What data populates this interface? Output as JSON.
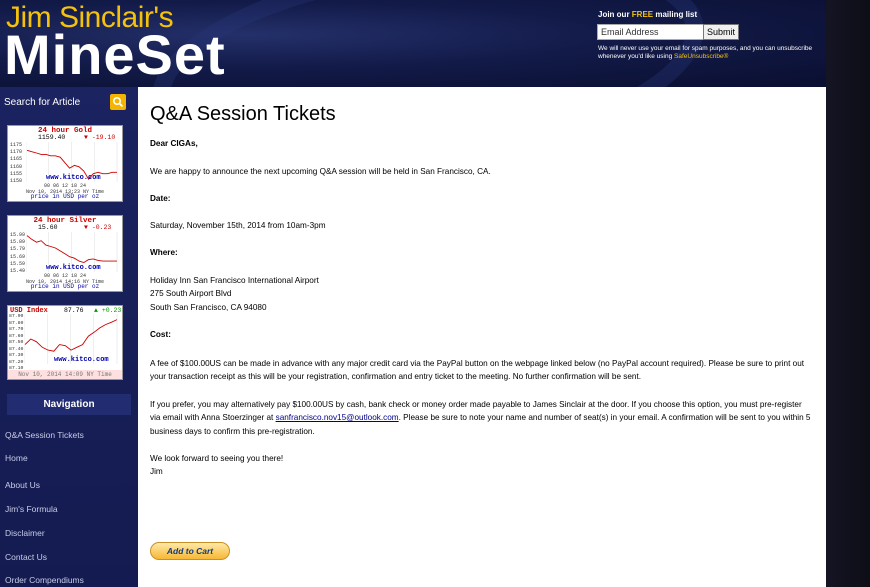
{
  "header": {
    "brand_top": "Jim Sinclair's",
    "brand_main": "MineSet",
    "mailing": {
      "title_prefix": "Join our ",
      "title_free": "FREE",
      "title_suffix": " mailing list",
      "email_value": "Email Address",
      "submit_label": "Submit",
      "note": "We will never use your email for spam purposes, and you can unsubscribe whenever you'd like using ",
      "note_link": "SafeUnsubscribe®"
    }
  },
  "sidebar": {
    "search_label": "Search for Article",
    "gold": {
      "title": "24 hour Gold",
      "price": "1159.40",
      "change": "-19.10",
      "y_ticks": [
        "1175",
        "1170",
        "1165",
        "1160",
        "1155",
        "1150"
      ],
      "source": "www.kitco.com",
      "x_note": "00 06 12 18 24",
      "date_note": "Nov 10, 2014 13:23 NY Time",
      "unit_note": "price in USD per oz",
      "series": [
        1171,
        1170,
        1169,
        1168,
        1168,
        1167,
        1167,
        1166,
        1162,
        1158,
        1160,
        1159,
        1156,
        1150,
        1154,
        1155,
        1154,
        1154,
        1155,
        1155
      ],
      "ylim": [
        1148,
        1177
      ]
    },
    "silver": {
      "title": "24 hour Silver",
      "price": "15.60",
      "change": "-0.23",
      "y_ticks": [
        "15.99",
        "15.89",
        "15.79",
        "15.69",
        "15.59",
        "15.49"
      ],
      "source": "www.kitco.com",
      "x_note": "00 06 12 18 24",
      "date_note": "Nov 10, 2014 14:16 NY Time",
      "unit_note": "price in USD per oz",
      "series": [
        15.95,
        15.9,
        15.86,
        15.88,
        15.82,
        15.8,
        15.78,
        15.74,
        15.7,
        15.66,
        15.64,
        15.6,
        15.58,
        15.62,
        15.63,
        15.61,
        15.6,
        15.6,
        15.6,
        15.6
      ],
      "ylim": [
        15.45,
        16.0
      ]
    },
    "usd": {
      "title": "USD Index",
      "value": "87.76",
      "change": "+0.23",
      "y_ticks": [
        "87.90",
        "87.80",
        "87.70",
        "87.60",
        "87.50",
        "87.40",
        "87.30",
        "87.20",
        "87.10"
      ],
      "source": "www.kitco.com",
      "x_note": "16110 20110 02110 08110 16100",
      "date_note": "Nov 10, 2014 14:09 NY Time",
      "series": [
        87.4,
        87.5,
        87.45,
        87.35,
        87.3,
        87.28,
        87.4,
        87.38,
        87.3,
        87.35,
        87.4,
        87.55,
        87.62,
        87.7,
        87.76,
        87.8,
        87.85
      ],
      "ylim": [
        87.05,
        87.95
      ]
    },
    "navigation_title": "Navigation",
    "nav_items": [
      "Q&A Session Tickets",
      "Home",
      "About Us",
      "Jim's Formula",
      "Disclaimer",
      "Contact Us",
      "Order Compendiums"
    ]
  },
  "content": {
    "title": "Q&A Session Tickets",
    "greeting": "Dear CIGAs,",
    "intro": "We are happy to announce the next upcoming Q&A session will be held in San Francisco, CA.",
    "date_label": "Date:",
    "date_value": "Saturday, November 15th, 2014 from 10am-3pm",
    "where_label": "Where:",
    "address_line1": "Holiday Inn San Francisco International Airport",
    "address_line2": "275 South Airport Blvd",
    "address_line3": "South San Francisco, CA 94080",
    "cost_label": "Cost:",
    "cost_text": "A fee of $100.00US can be made in advance with any major credit card via the PayPal button on the webpage linked below (no PayPal account required). Please be sure to print out your transaction receipt as this will be your registration, confirmation and entry ticket to the meeting. No further confirmation will be sent.",
    "alt_text_before": "If you prefer, you may alternatively pay $100.00US by cash, bank check or money order made payable to James Sinclair at the door. If you choose this option, you must pre-register via email with Anna Stoerzinger at ",
    "alt_email": "sanfrancisco.nov15@outlook.com",
    "alt_text_after": ". Please be sure to note your name and number of seat(s) in your email. A confirmation will be sent to you within 5 business days to confirm this pre-registration.",
    "closing1": "We look forward to seeing you there!",
    "closing2": "Jim",
    "cart_button": "Add to Cart"
  }
}
